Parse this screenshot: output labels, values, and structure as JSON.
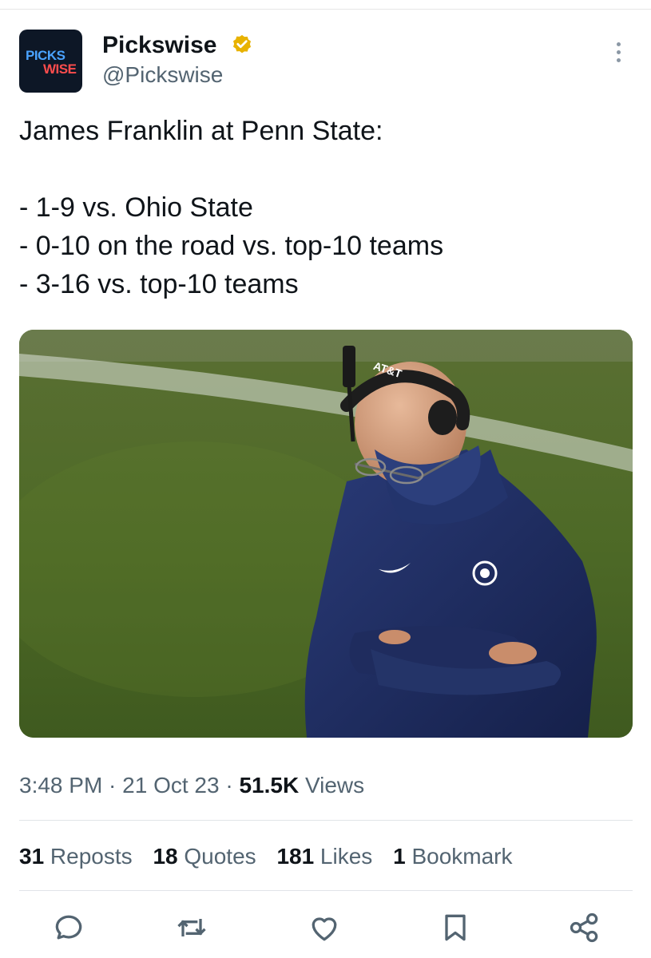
{
  "account": {
    "avatar_text_top": "PICKS",
    "avatar_text_bottom": "WISE",
    "display_name": "Pickswise",
    "handle": "@Pickswise",
    "verified_color": "#e8b200"
  },
  "tweet": {
    "lines": [
      "James Franklin at Penn State:",
      "",
      "- 1-9 vs. Ohio State",
      "- 0-10 on the road vs. top-10 teams",
      "- 3-16 vs. top-10 teams"
    ],
    "image": {
      "headset_text": "AT&T"
    }
  },
  "meta": {
    "time": "3:48 PM",
    "separator": " · ",
    "date": "21 Oct 23",
    "views_count": "51.5K",
    "views_label": " Views"
  },
  "stats": [
    {
      "count": "31",
      "label": " Reposts"
    },
    {
      "count": "18",
      "label": " Quotes"
    },
    {
      "count": "181",
      "label": " Likes"
    },
    {
      "count": "1",
      "label": " Bookmark"
    }
  ],
  "actions": [
    "reply-icon",
    "repost-icon",
    "like-icon",
    "bookmark-icon",
    "share-icon"
  ],
  "colors": {
    "text": "#0f1419",
    "muted": "#536471",
    "icon": "#536471"
  }
}
